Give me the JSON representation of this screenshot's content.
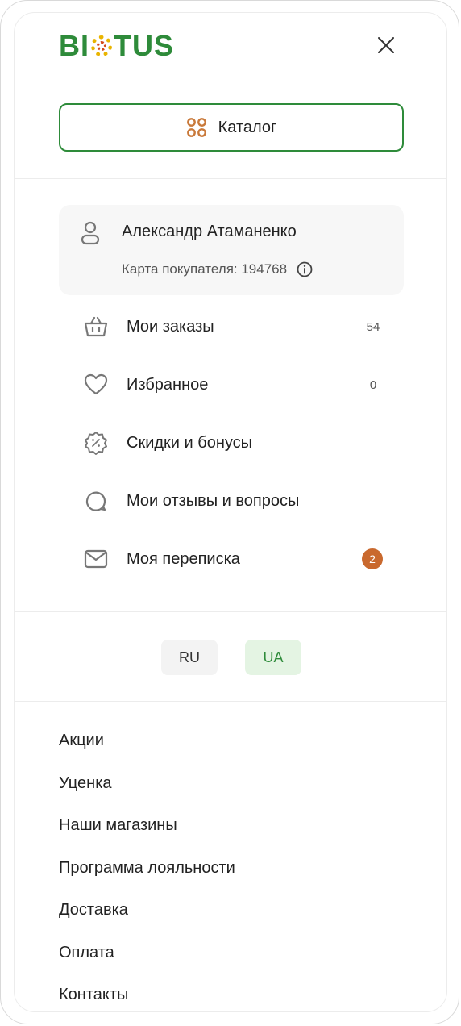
{
  "brand": {
    "logo_prefix": "BI",
    "logo_suffix": "TUS"
  },
  "catalog": {
    "label": "Каталог"
  },
  "user": {
    "name": "Александр Атаманенко",
    "card": "Карта покупателя: 194768"
  },
  "menu": [
    {
      "label": "Мои заказы",
      "count": "54",
      "icon": "basket-icon"
    },
    {
      "label": "Избранное",
      "count": "0",
      "icon": "heart-icon"
    },
    {
      "label": "Скидки и бонусы",
      "count": "",
      "icon": "discount-icon"
    },
    {
      "label": "Мои отзывы и вопросы",
      "count": "",
      "icon": "chat-icon"
    },
    {
      "label": "Моя переписка",
      "badge": "2",
      "icon": "mail-icon"
    }
  ],
  "languages": {
    "ru": "RU",
    "ua": "UA",
    "active": "UA"
  },
  "links": [
    "Акции",
    "Уценка",
    "Наши магазины",
    "Программа лояльности",
    "Доставка",
    "Оплата",
    "Контакты"
  ],
  "colors": {
    "brand_green": "#2e8b3a",
    "accent_orange": "#c9692e",
    "catalog_icon": "#c9793a"
  }
}
